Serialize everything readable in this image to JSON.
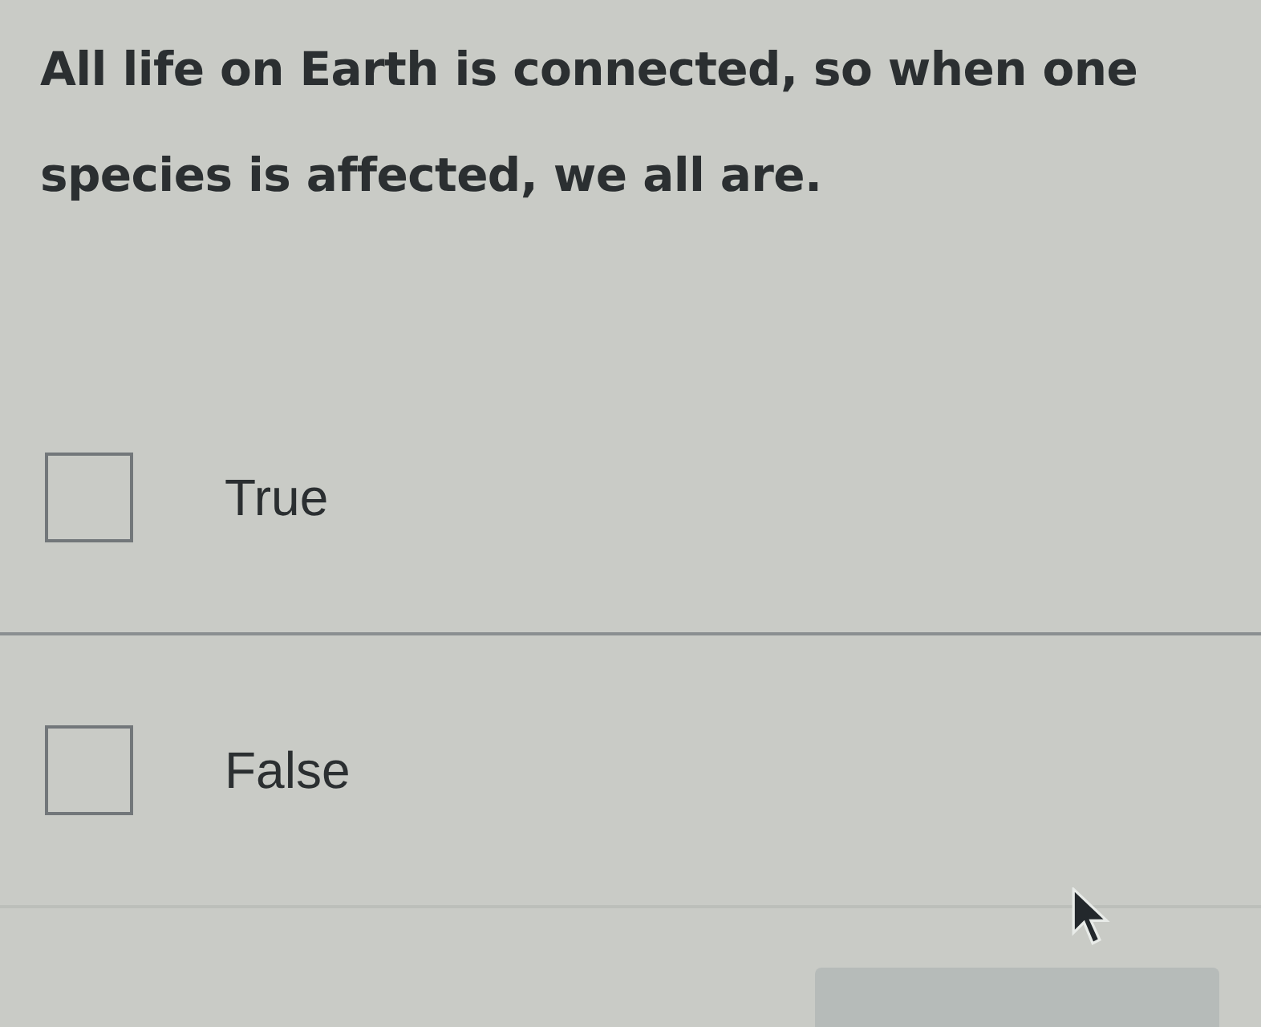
{
  "question": {
    "text": "All life on Earth is connected, so when one species is affected, we all are."
  },
  "options": [
    {
      "label": "True",
      "checked": false
    },
    {
      "label": "False",
      "checked": false
    }
  ]
}
